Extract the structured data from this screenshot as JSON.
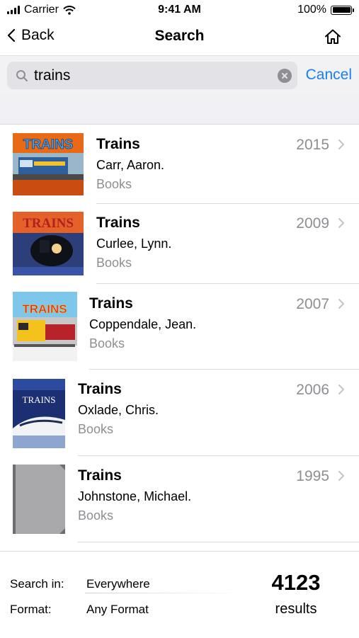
{
  "status_bar": {
    "carrier": "Carrier",
    "time": "9:41 AM",
    "battery": "100%"
  },
  "nav": {
    "back_label": "Back",
    "title": "Search"
  },
  "search": {
    "query": "trains",
    "cancel_label": "Cancel"
  },
  "results": [
    {
      "title": "Trains",
      "author": "Carr, Aaron.",
      "format": "Books",
      "year": "2015",
      "cover_text": "TRAINS"
    },
    {
      "title": "Trains",
      "author": "Curlee, Lynn.",
      "format": "Books",
      "year": "2009",
      "cover_text": "TRAINS"
    },
    {
      "title": "Trains",
      "author": "Coppendale, Jean.",
      "format": "Books",
      "year": "2007",
      "cover_text": "TRAINS"
    },
    {
      "title": "Trains",
      "author": "Oxlade, Chris.",
      "format": "Books",
      "year": "2006",
      "cover_text": "TRAINS"
    },
    {
      "title": "Trains",
      "author": "Johnstone, Michael.",
      "format": "Books",
      "year": "1995",
      "cover_text": ""
    }
  ],
  "footer": {
    "search_in_label": "Search in:",
    "search_in_value": "Everywhere",
    "format_label": "Format:",
    "format_value": "Any Format",
    "count": "4123",
    "count_label": "results"
  },
  "colors": {
    "accent": "#1a7ff0",
    "secondary_text": "#8e8e93",
    "search_bg": "#e3e3e7"
  }
}
